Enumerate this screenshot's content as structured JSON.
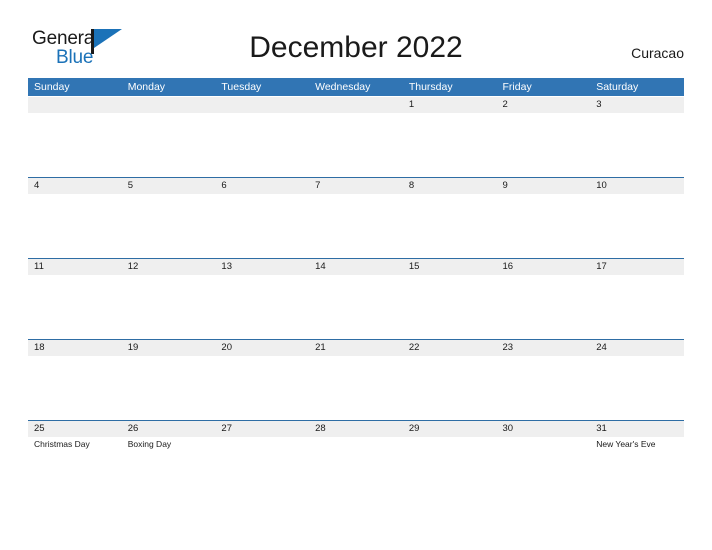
{
  "brand": {
    "name_part1": "General",
    "name_part2": "Blue",
    "flag_icon": "flag-triangle-icon"
  },
  "header": {
    "title": "December 2022",
    "locale": "Curacao"
  },
  "calendar": {
    "weekdays": [
      "Sunday",
      "Monday",
      "Tuesday",
      "Wednesday",
      "Thursday",
      "Friday",
      "Saturday"
    ],
    "header_bg": "#3175b4",
    "band_bg": "#efefef",
    "rule_color": "#2e6da4",
    "weeks": [
      {
        "days": [
          {
            "number": "",
            "event": ""
          },
          {
            "number": "",
            "event": ""
          },
          {
            "number": "",
            "event": ""
          },
          {
            "number": "",
            "event": ""
          },
          {
            "number": "1",
            "event": ""
          },
          {
            "number": "2",
            "event": ""
          },
          {
            "number": "3",
            "event": ""
          }
        ]
      },
      {
        "days": [
          {
            "number": "4",
            "event": ""
          },
          {
            "number": "5",
            "event": ""
          },
          {
            "number": "6",
            "event": ""
          },
          {
            "number": "7",
            "event": ""
          },
          {
            "number": "8",
            "event": ""
          },
          {
            "number": "9",
            "event": ""
          },
          {
            "number": "10",
            "event": ""
          }
        ]
      },
      {
        "days": [
          {
            "number": "11",
            "event": ""
          },
          {
            "number": "12",
            "event": ""
          },
          {
            "number": "13",
            "event": ""
          },
          {
            "number": "14",
            "event": ""
          },
          {
            "number": "15",
            "event": ""
          },
          {
            "number": "16",
            "event": ""
          },
          {
            "number": "17",
            "event": ""
          }
        ]
      },
      {
        "days": [
          {
            "number": "18",
            "event": ""
          },
          {
            "number": "19",
            "event": ""
          },
          {
            "number": "20",
            "event": ""
          },
          {
            "number": "21",
            "event": ""
          },
          {
            "number": "22",
            "event": ""
          },
          {
            "number": "23",
            "event": ""
          },
          {
            "number": "24",
            "event": ""
          }
        ]
      },
      {
        "days": [
          {
            "number": "25",
            "event": "Christmas Day"
          },
          {
            "number": "26",
            "event": "Boxing Day"
          },
          {
            "number": "27",
            "event": ""
          },
          {
            "number": "28",
            "event": ""
          },
          {
            "number": "29",
            "event": ""
          },
          {
            "number": "30",
            "event": ""
          },
          {
            "number": "31",
            "event": "New Year's Eve"
          }
        ]
      }
    ]
  }
}
